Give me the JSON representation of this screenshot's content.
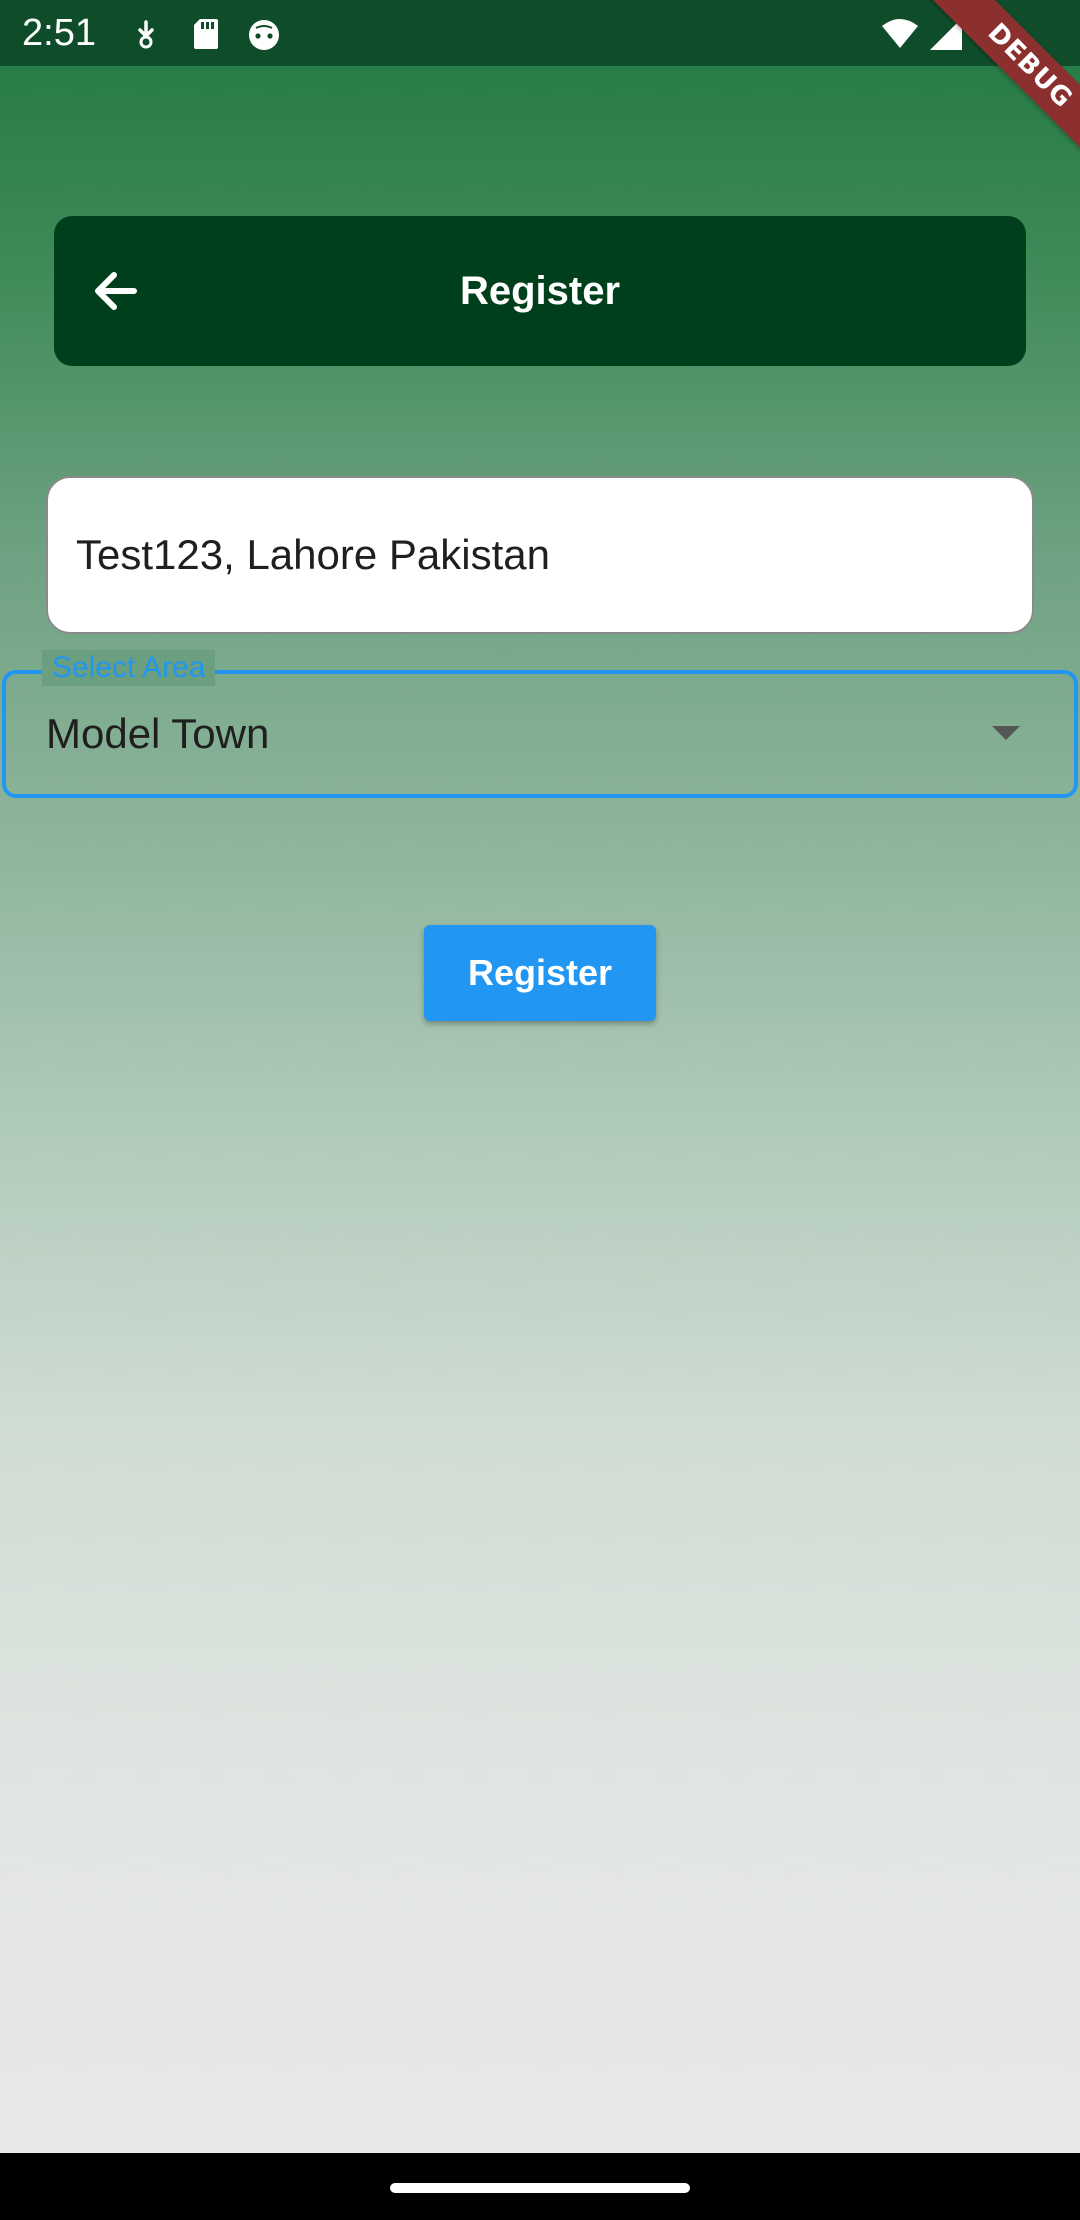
{
  "status_bar": {
    "time": "2:51",
    "left_icons": [
      "download-icon",
      "sd-card-icon",
      "android-face-icon"
    ],
    "right_icons": [
      "wifi-icon",
      "signal-icon",
      "battery-icon"
    ],
    "background": "#0f4d2a"
  },
  "debug_banner": {
    "text": "DEBUG",
    "color": "#8b2f2f"
  },
  "app_bar": {
    "title": "Register",
    "back_icon": "arrow-back-icon",
    "background": "#003f1c"
  },
  "form": {
    "address": {
      "value": "Test123, Lahore Pakistan",
      "placeholder": ""
    },
    "area_select": {
      "label": "Select Area",
      "selected": "Model Town",
      "accent": "#2196f3"
    },
    "submit": {
      "label": "Register",
      "color": "#2196f3"
    }
  }
}
